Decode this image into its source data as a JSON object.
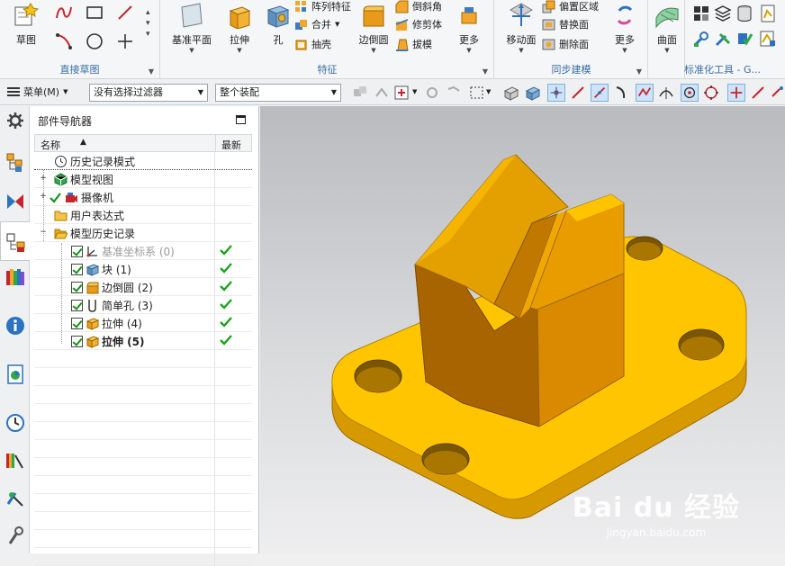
{
  "ribbon": {
    "groups": [
      {
        "label": "直接草图"
      },
      {
        "label": "特征"
      },
      {
        "label": "同步建模"
      },
      {
        "label": "标准化工具 - G..."
      }
    ],
    "sketch": {
      "label": "草图"
    },
    "datum_plane": {
      "label": "基准平面"
    },
    "extrude": {
      "label": "拉伸"
    },
    "hole": {
      "label": "孔"
    },
    "pattern_feature": {
      "label": "阵列特征"
    },
    "unite": {
      "label": "合并"
    },
    "shell": {
      "label": "抽壳"
    },
    "edge_blend": {
      "label": "边倒圆"
    },
    "chamfer": {
      "label": "倒斜角"
    },
    "trim_body": {
      "label": "修剪体"
    },
    "draft": {
      "label": "拔模"
    },
    "more_feature": {
      "label": "更多"
    },
    "move_face": {
      "label": "移动面"
    },
    "offset_region": {
      "label": "偏置区域"
    },
    "replace_face": {
      "label": "替换面"
    },
    "delete_face": {
      "label": "删除面"
    },
    "more_sync": {
      "label": "更多"
    },
    "surface": {
      "label": "曲面"
    }
  },
  "toolbar": {
    "menu_label": "菜单(M)",
    "filter_value": "没有选择过滤器",
    "scope_value": "整个装配"
  },
  "navigator": {
    "title": "部件导航器",
    "columns": {
      "name": "名称",
      "latest": "最新"
    },
    "nodes": [
      {
        "label": "历史记录模式"
      },
      {
        "label": "模型视图"
      },
      {
        "label": "摄像机"
      },
      {
        "label": "用户表达式"
      },
      {
        "label": "模型历史记录"
      },
      {
        "label": "基准坐标系 (0)"
      },
      {
        "label": "块 (1)"
      },
      {
        "label": "边倒圆 (2)"
      },
      {
        "label": "简单孔 (3)"
      },
      {
        "label": "拉伸 (4)"
      },
      {
        "label": "拉伸 (5)"
      }
    ]
  },
  "viewport": {
    "watermark_main": "Bai du 经验",
    "watermark_sub": "jingyan.baidu.com",
    "part_color": "#f5b800"
  }
}
